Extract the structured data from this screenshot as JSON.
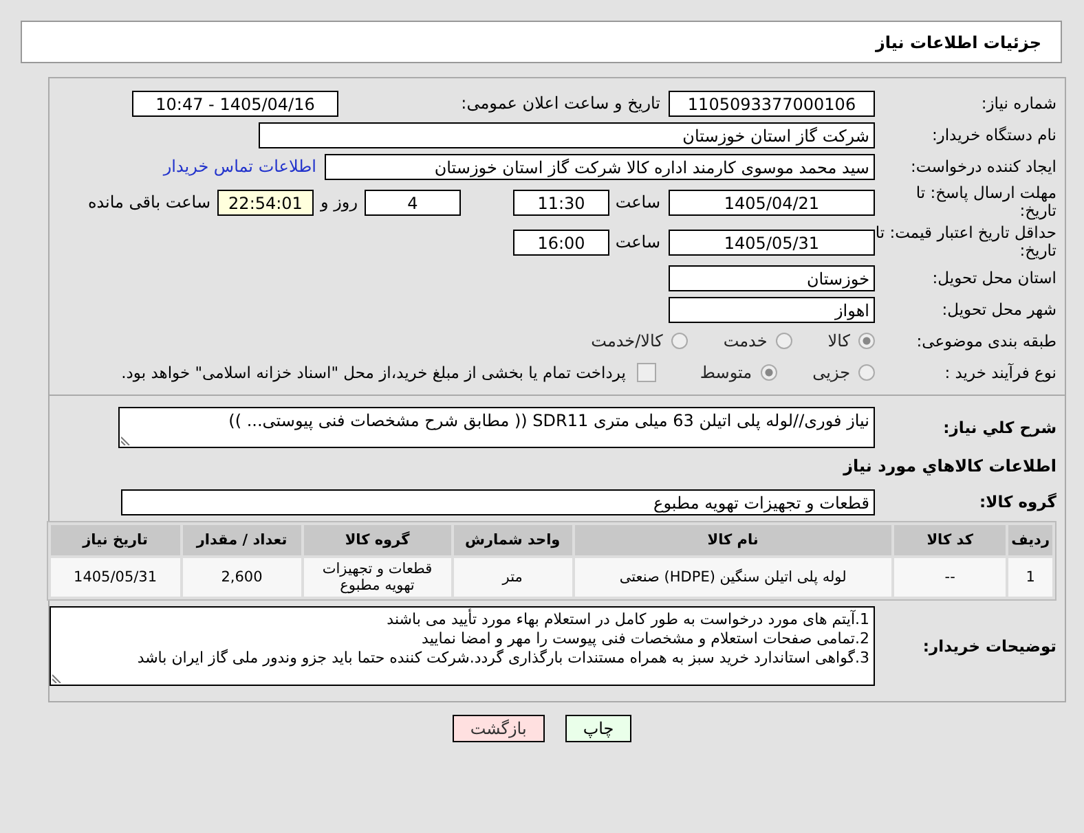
{
  "page_title": "جزئیات اطلاعات نیاز",
  "need_number": {
    "label": "شماره نیاز:",
    "value": "1105093377000106"
  },
  "announce": {
    "label": "تاریخ و ساعت اعلان عمومی:",
    "value": "1405/04/16 - 10:47"
  },
  "buyer_org": {
    "label": "نام دستگاه خریدار:",
    "value": "شرکت گاز استان خوزستان"
  },
  "creator": {
    "label": "ایجاد کننده درخواست:",
    "value": "سید محمد موسوی کارمند اداره کالا شرکت گاز استان خوزستان",
    "link": "اطلاعات تماس خریدار"
  },
  "deadline": {
    "label": "مهلت ارسال پاسخ: تا تاریخ:",
    "date": "1405/04/21",
    "time_label": "ساعت",
    "time": "11:30",
    "days": "4",
    "days_label": "روز و",
    "remaining": "22:54:01",
    "remaining_label": "ساعت باقی مانده"
  },
  "price_validity": {
    "label": "حداقل تاریخ اعتبار قیمت: تا تاریخ:",
    "date": "1405/05/31",
    "time_label": "ساعت",
    "time": "16:00"
  },
  "province": {
    "label": "استان محل تحویل:",
    "value": "خوزستان"
  },
  "city": {
    "label": "شهر محل تحویل:",
    "value": "اهواز"
  },
  "category": {
    "label": "طبقه بندی موضوعی:",
    "options": [
      {
        "label": "کالا",
        "selected": true
      },
      {
        "label": "خدمت",
        "selected": false
      },
      {
        "label": "کالا/خدمت",
        "selected": false
      }
    ]
  },
  "process": {
    "label": "نوع فرآیند خرید :",
    "options": [
      {
        "label": "جزیی",
        "selected": false
      },
      {
        "label": "متوسط",
        "selected": true
      }
    ],
    "payment_checkbox": {
      "label": "پرداخت تمام یا بخشی از مبلغ خرید،از محل \"اسناد خزانه اسلامی\" خواهد بود.",
      "checked": false
    }
  },
  "description": {
    "label": "شرح کلي نياز:",
    "value": "نیاز فوری//لوله پلی اتیلن 63 میلی متری SDR11 (( مطابق شرح مشخصات فنی پیوستی... ))"
  },
  "goods_section_title": "اطلاعات کالاهاي مورد نياز",
  "goods_group": {
    "label": "گروه کالا:",
    "value": "قطعات و تجهیزات تهویه مطبوع"
  },
  "table": {
    "columns": [
      "ردیف",
      "کد کالا",
      "نام کالا",
      "واحد شمارش",
      "گروه کالا",
      "تعداد / مقدار",
      "تاریخ نیاز"
    ],
    "rows": [
      [
        "1",
        "--",
        "لوله پلی اتیلن سنگین (HDPE) صنعتی",
        "متر",
        "قطعات و تجهیزات تهویه مطبوع",
        "2,600",
        "1405/05/31"
      ]
    ]
  },
  "buyer_notes": {
    "label": "توضیحات خریدار:",
    "lines": [
      "1.آیتم های مورد درخواست به طور کامل در استعلام بهاء مورد تأیید می باشند",
      "2.تمامی صفحات استعلام و مشخصات فنی پیوست را مهر و امضا نمایید",
      "3.گواهی استاندارد خرید سبز به همراه مستندات بارگذاری گردد.شرکت کننده حتما باید جزو وندور ملی گاز ایران باشد"
    ]
  },
  "buttons": [
    {
      "label": "چاپ",
      "kind": "print"
    },
    {
      "label": "بازگشت",
      "kind": "back"
    }
  ]
}
